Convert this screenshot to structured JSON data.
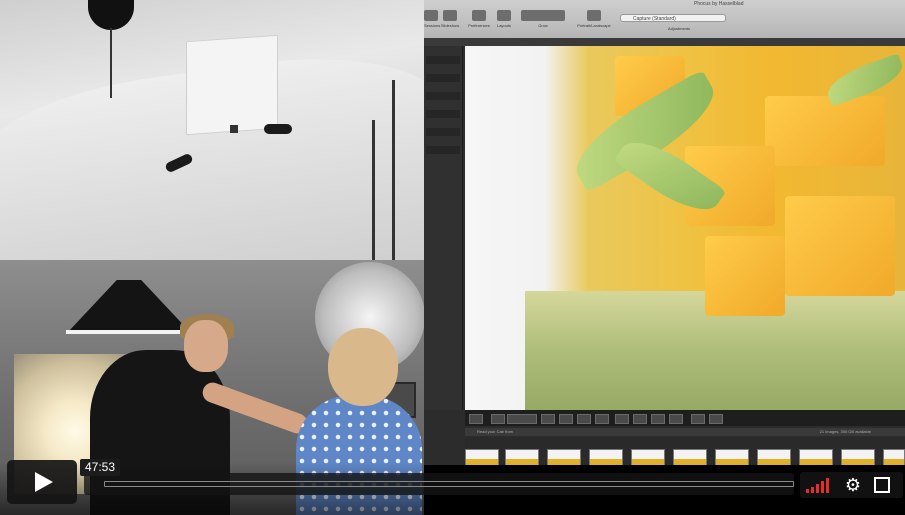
{
  "player": {
    "timestamp": "47:53",
    "play_icon": "play-icon",
    "quality_icon": "signal-bars-icon",
    "settings_icon": "gear-icon",
    "fullscreen_icon": "fullscreen-icon"
  },
  "software": {
    "title": "Phocus by Hasselblad",
    "toolbar": {
      "items": [
        "Sessions",
        "Slideshow",
        "Preferences",
        "Layouts",
        "Grow",
        "Portrait/Landscape"
      ],
      "capture_value": "Capture (Standard)",
      "adjustments_label": "Adjustments"
    },
    "filmstrip": {
      "title": "Read your Cab from",
      "count": "21 Images, 350 GB available"
    }
  },
  "colors": {
    "accent": "#e52d2d",
    "control_bg": "#1c1c1c"
  }
}
